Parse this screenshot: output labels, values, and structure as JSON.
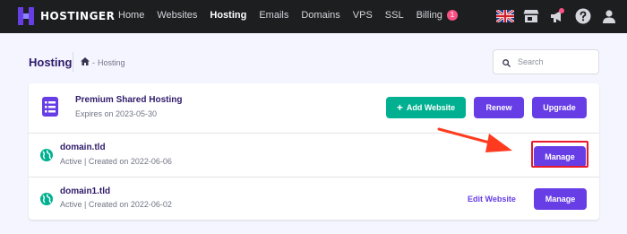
{
  "brand": {
    "name": "HOSTINGER"
  },
  "nav": [
    {
      "label": "Home",
      "active": false
    },
    {
      "label": "Websites",
      "active": false
    },
    {
      "label": "Hosting",
      "active": true
    },
    {
      "label": "Emails",
      "active": false
    },
    {
      "label": "Domains",
      "active": false
    },
    {
      "label": "VPS",
      "active": false
    },
    {
      "label": "SSL",
      "active": false
    },
    {
      "label": "Billing",
      "active": false,
      "badge": "1"
    }
  ],
  "top_icons": [
    "uk-flag-icon",
    "store-icon",
    "megaphone-icon",
    "help-icon",
    "user-icon"
  ],
  "header": {
    "title": "Hosting",
    "breadcrumb": {
      "separator": "-",
      "current": "Hosting"
    },
    "search_placeholder": "Search"
  },
  "plan": {
    "name": "Premium Shared Hosting",
    "expires": "Expires on 2023-05-30",
    "add_website_label": "Add Website",
    "add_website_plus": "+",
    "renew_label": "Renew",
    "upgrade_label": "Upgrade"
  },
  "domains": [
    {
      "name": "domain.tld",
      "status": "Active | Created on 2022-06-06",
      "manage_label": "Manage"
    },
    {
      "name": "domain1.tld",
      "status": "Active | Created on 2022-06-02",
      "edit_label": "Edit Website",
      "manage_label": "Manage"
    }
  ],
  "colors": {
    "topbar": "#1d1e20",
    "primary": "#673de6",
    "green": "#00b090",
    "badge": "#fc5185",
    "highlight": "#e8192c",
    "arrow": "#ff3b1f"
  }
}
